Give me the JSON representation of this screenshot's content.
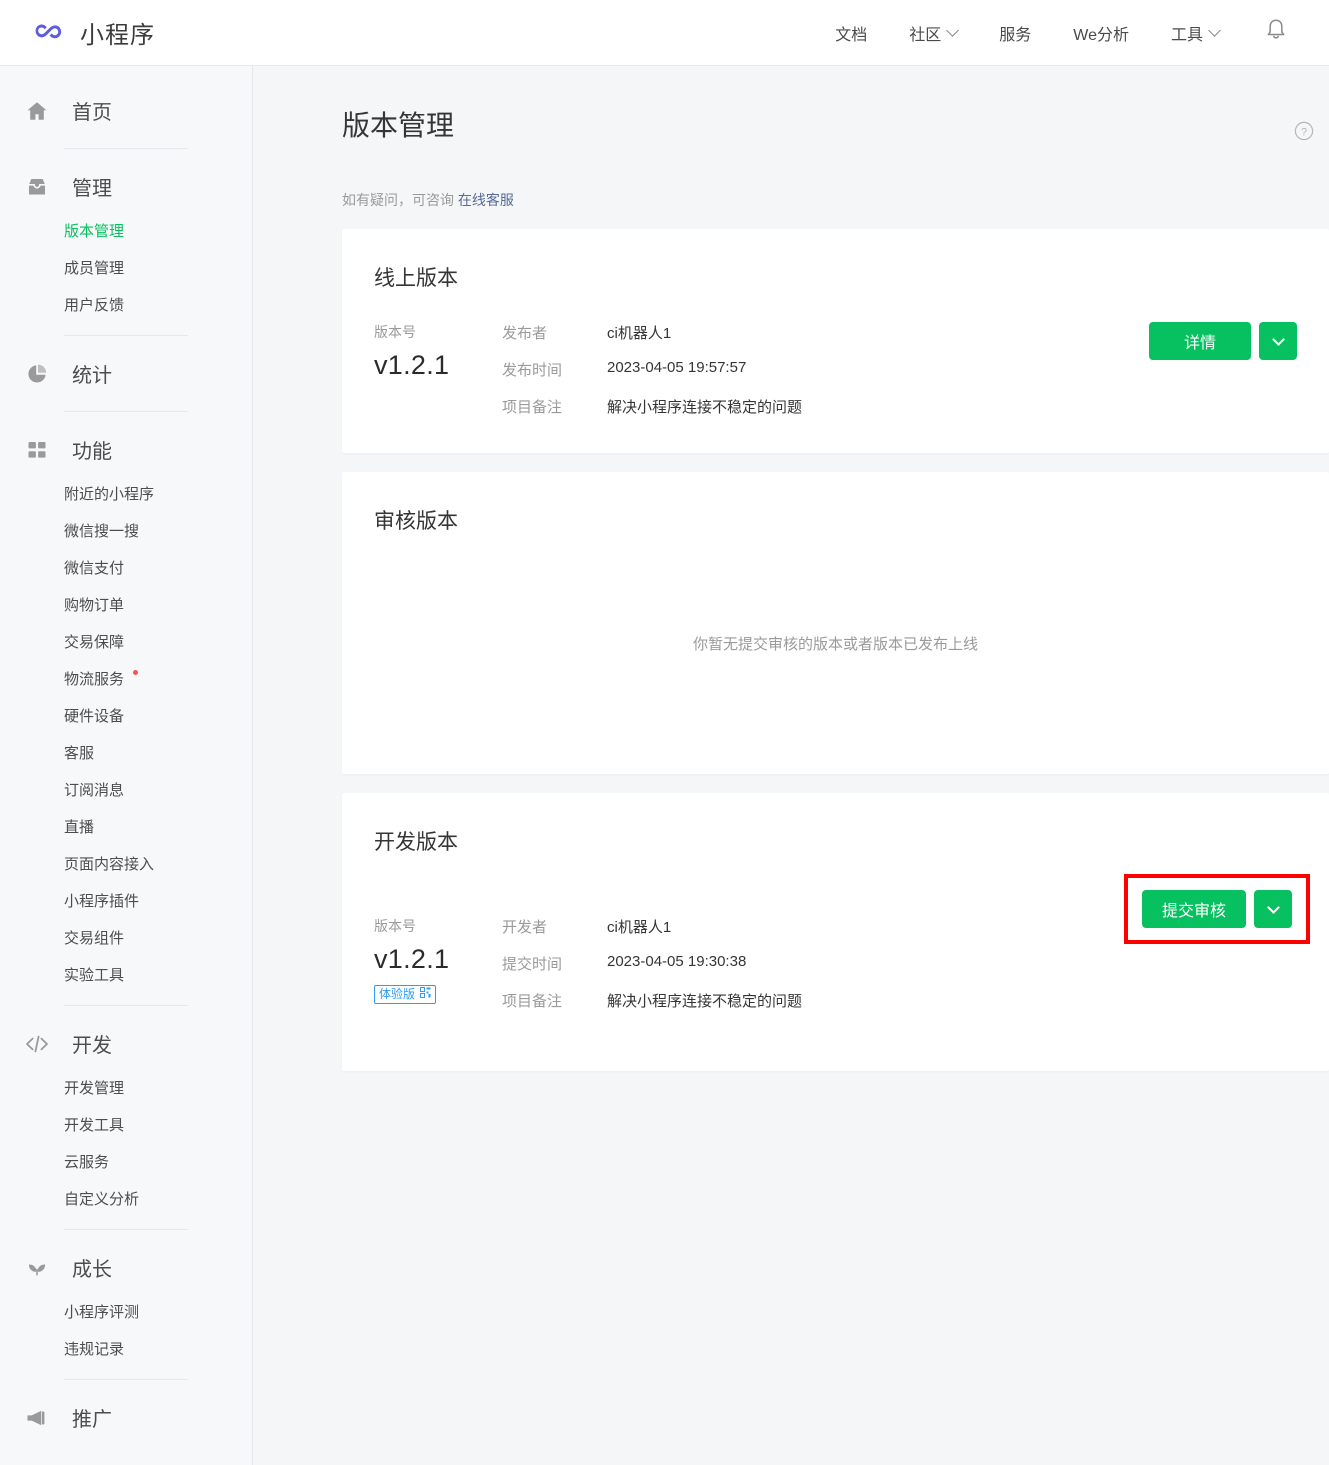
{
  "header": {
    "brand": "小程序",
    "logo_icon": "mini-program-logo",
    "nav": [
      {
        "label": "文档",
        "has_chevron": false
      },
      {
        "label": "社区",
        "has_chevron": true
      },
      {
        "label": "服务",
        "has_chevron": false
      },
      {
        "label": "We分析",
        "has_chevron": false
      },
      {
        "label": "工具",
        "has_chevron": true
      }
    ],
    "bell_icon": "bell-icon"
  },
  "sidebar": {
    "groups": [
      {
        "label": "首页",
        "icon": "home-icon",
        "items": []
      },
      {
        "label": "管理",
        "icon": "inbox-icon",
        "items": [
          {
            "label": "版本管理",
            "active": true
          },
          {
            "label": "成员管理",
            "active": false
          },
          {
            "label": "用户反馈",
            "active": false
          }
        ]
      },
      {
        "label": "统计",
        "icon": "pie-chart-icon",
        "items": []
      },
      {
        "label": "功能",
        "icon": "grid-icon",
        "items": [
          {
            "label": "附近的小程序",
            "active": false
          },
          {
            "label": "微信搜一搜",
            "active": false
          },
          {
            "label": "微信支付",
            "active": false
          },
          {
            "label": "购物订单",
            "active": false
          },
          {
            "label": "交易保障",
            "active": false
          },
          {
            "label": "物流服务",
            "active": false,
            "badge": true
          },
          {
            "label": "硬件设备",
            "active": false
          },
          {
            "label": "客服",
            "active": false
          },
          {
            "label": "订阅消息",
            "active": false
          },
          {
            "label": "直播",
            "active": false
          },
          {
            "label": "页面内容接入",
            "active": false
          },
          {
            "label": "小程序插件",
            "active": false
          },
          {
            "label": "交易组件",
            "active": false
          },
          {
            "label": "实验工具",
            "active": false
          }
        ]
      },
      {
        "label": "开发",
        "icon": "code-icon",
        "items": [
          {
            "label": "开发管理",
            "active": false
          },
          {
            "label": "开发工具",
            "active": false
          },
          {
            "label": "云服务",
            "active": false
          },
          {
            "label": "自定义分析",
            "active": false
          }
        ]
      },
      {
        "label": "成长",
        "icon": "sprout-icon",
        "items": [
          {
            "label": "小程序评测",
            "active": false
          },
          {
            "label": "违规记录",
            "active": false
          }
        ]
      },
      {
        "label": "推广",
        "icon": "megaphone-icon",
        "items": []
      }
    ]
  },
  "page": {
    "title": "版本管理",
    "help_icon": "question-circle-icon",
    "tip_text": "如有疑问，可咨询 ",
    "tip_link": "在线客服"
  },
  "cards": {
    "online": {
      "title": "线上版本",
      "version_label": "版本号",
      "version": "v1.2.1",
      "rows": [
        {
          "key": "发布者",
          "value": "ci机器人1"
        },
        {
          "key": "发布时间",
          "value": "2023-04-05 19:57:57"
        },
        {
          "key": "项目备注",
          "value": "解决小程序连接不稳定的问题"
        }
      ],
      "primary_button": "详情",
      "dropdown_icon": "chevron-down-icon"
    },
    "review": {
      "title": "审核版本",
      "empty_text": "你暂无提交审核的版本或者版本已发布上线"
    },
    "dev": {
      "title": "开发版本",
      "version_label": "版本号",
      "version": "v1.2.1",
      "badge_text": "体验版",
      "badge_icon": "qrcode-icon",
      "rows": [
        {
          "key": "开发者",
          "value": "ci机器人1"
        },
        {
          "key": "提交时间",
          "value": "2023-04-05 19:30:38"
        },
        {
          "key": "项目备注",
          "value": "解决小程序连接不稳定的问题"
        }
      ],
      "primary_button": "提交审核",
      "dropdown_icon": "chevron-down-icon",
      "highlighted": true
    }
  },
  "colors": {
    "brand_green": "#07c160",
    "logo_purple": "#5d5ce0",
    "link_blue": "#576b95",
    "badge_blue": "#2f9cf4",
    "highlight_red": "#ff0000",
    "alert_dot_red": "#fa5151"
  }
}
